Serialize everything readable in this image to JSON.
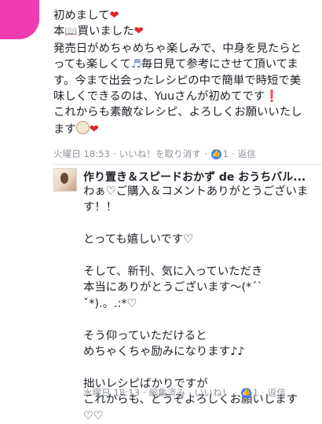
{
  "comment": {
    "line1": "初めまして",
    "line2a": "本",
    "line2b": "買いました",
    "line3": "発売日がめちゃめちゃ楽しみで、中身を見たらと",
    "line4a": "っても楽しくて",
    "line4b": "毎日見て参考にさせて頂いてま",
    "line5": "す。今まで出会ったレシピの中で簡単で時短で美",
    "line6a": "味しくできるのは、Yuuさんが初めてです",
    "line7": "これからも素敵なレシピ、よろしくお願いいたし",
    "line8": "ます",
    "meta": {
      "time": "火曜日 18:53",
      "unlike": "いいね！を取り消す",
      "likes": "1",
      "reply": "返信"
    }
  },
  "icons": {
    "heart": "❤",
    "book": "📖",
    "music_note": "♬",
    "exclamation": "❗",
    "like": "👍"
  },
  "reply": {
    "author": "作り置き＆スピードおかず de おうちバル...",
    "text": "わぁ♡ご購入＆コメントありがとうございま\nす！！\n\nとっても嬉しいです♡\n\nそして、新刊、気に入っていただき\n本当にありがとうございます〜(*ˊˋ\nˇ*).。.:*♡\n\nそう仰っていただけると\nめちゃくちゃ励みになります♪♪\n\n拙いレシピばかりですが\nこれからも、どうぞよろしくお願いします\n♡♡",
    "meta": {
      "time": "水曜日 18:13",
      "edited": "編集済み",
      "like": "いいね！",
      "likes": "1",
      "reply": "返信"
    }
  }
}
